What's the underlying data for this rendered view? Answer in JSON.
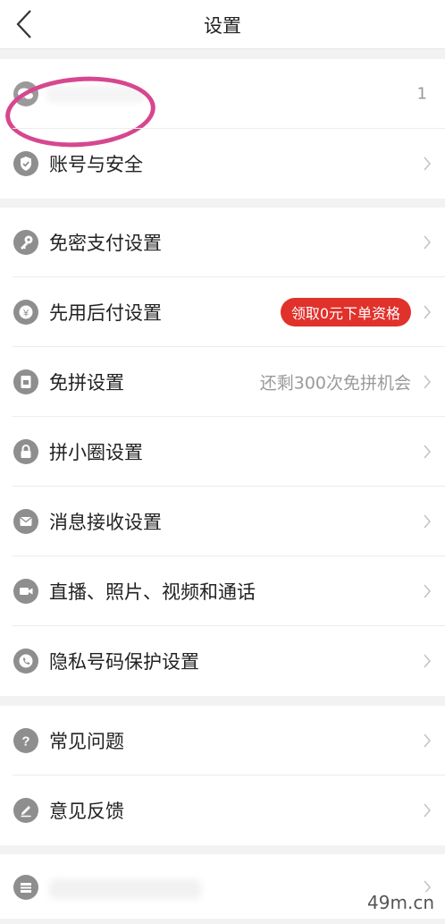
{
  "header": {
    "title": "设置"
  },
  "account": {
    "count": "1"
  },
  "group1": [
    {
      "label": "账号与安全"
    }
  ],
  "group2": [
    {
      "label": "免密支付设置"
    },
    {
      "label": "先用后付设置",
      "badge": "领取0元下单资格"
    },
    {
      "label": "免拼设置",
      "extra": "还剩300次免拼机会"
    },
    {
      "label": "拼小圈设置"
    },
    {
      "label": "消息接收设置"
    },
    {
      "label": "直播、照片、视频和通话"
    },
    {
      "label": "隐私号码保护设置"
    }
  ],
  "group3": [
    {
      "label": "常见问题"
    },
    {
      "label": "意见反馈"
    }
  ],
  "watermark": "49m.cn",
  "colors": {
    "accent_badge": "#e0312b",
    "highlight": "#d6478f",
    "icon_gray": "#8e8e8e"
  }
}
